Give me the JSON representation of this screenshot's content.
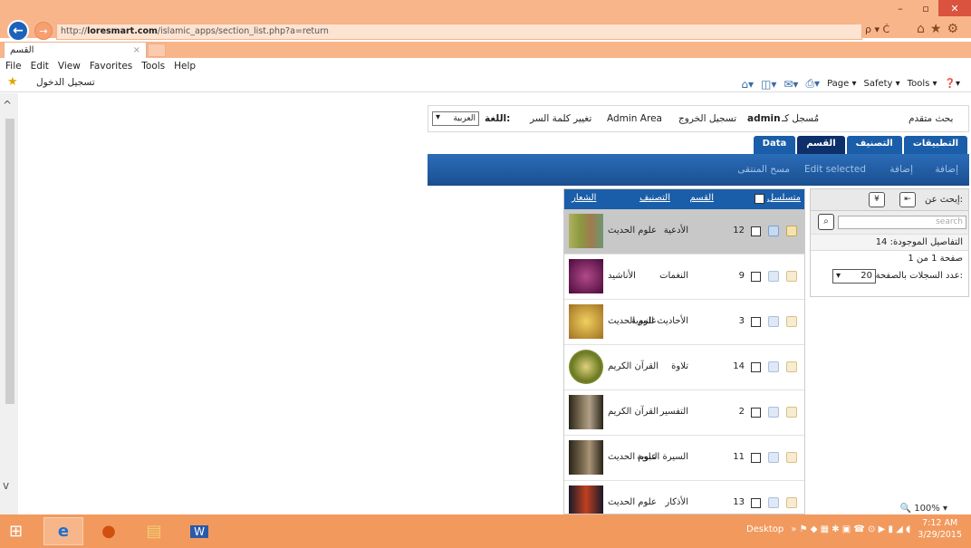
{
  "browser": {
    "url_prefix": "http://",
    "url_domain": "loresmart.com",
    "url_path": "/islamic_apps/section_list.php?a=return",
    "addr_tools": "ρ ▾ Ċ",
    "tab_title": "القسم",
    "tab_close": "×",
    "window_min": "–",
    "window_max": "▫",
    "window_close": "✕",
    "back": "←",
    "forward": "→",
    "chrome_icons": "⌂★⚙",
    "menu": [
      "File",
      "Edit",
      "View",
      "Favorites",
      "Tools",
      "Help"
    ],
    "favorite_link": "تسجيل الدخول",
    "command_bar": [
      "Page ▾",
      "Safety ▾",
      "Tools ▾",
      "❓▾"
    ],
    "zoom": "🔍 100%  ▾"
  },
  "header": {
    "language_label": "اللغة:",
    "language_value": "العربية",
    "change_password": "تغيير كلمة السر",
    "admin_area": "Admin Area",
    "logout": "تسجيل الخروج",
    "logged_in_as": "مُسجل كـ",
    "username": "admin",
    "advanced_search": "بحث متقدم"
  },
  "tabs": [
    "التطبيقات",
    "التصنيف",
    "القسم",
    "Data"
  ],
  "toolbar": {
    "add": "إضافة",
    "add2": "إضافة",
    "edit_selected": "Edit selected",
    "delete_selected": "مسح المنتقى"
  },
  "filter": {
    "search_in": "إبحث عن:",
    "search_placeholder": "search",
    "records_found": "التفاصيل الموجودة: 14",
    "page_of": "صفحة 1 من 1",
    "per_page_label": "عدد السجلات بالصفحة:",
    "per_page_value": "20"
  },
  "grid": {
    "headers": [
      "متسلسل",
      "القسم",
      "التصنيف",
      "الشعار"
    ],
    "rows": [
      {
        "id": "12",
        "name": "الأدعية",
        "category": "علوم الحديث"
      },
      {
        "id": "9",
        "name": "النغمات",
        "category": "الأناشيد"
      },
      {
        "id": "3",
        "name": "الأحاديث النبوية",
        "category": "علوم الحديث"
      },
      {
        "id": "14",
        "name": "تلاوة",
        "category": "القرآن الكريم"
      },
      {
        "id": "2",
        "name": "التفسير",
        "category": "القرآن الكريم"
      },
      {
        "id": "11",
        "name": "السيرة النبوية",
        "category": "علوم الحديث"
      },
      {
        "id": "13",
        "name": "الأذكار",
        "category": "علوم الحديث"
      }
    ]
  },
  "taskbar": {
    "desktop": "Desktop",
    "time": "7:12 AM",
    "date": "3/29/2015"
  }
}
